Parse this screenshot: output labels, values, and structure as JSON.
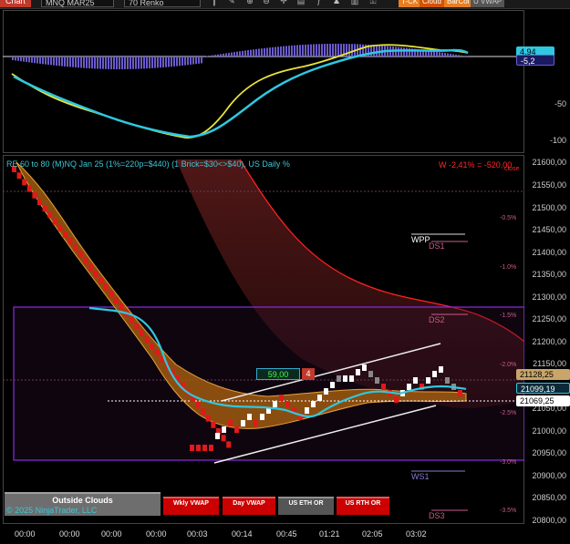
{
  "toolbar": {
    "tab": "Chart",
    "instrument": "MNQ MAR25",
    "bar_type": "70 Renko",
    "buttons": [
      "T-CK",
      "Cloud",
      "BarCol",
      "U VWAP"
    ],
    "icons": [
      "bars-icon",
      "draw-icon",
      "zoom-in-icon",
      "zoom-out-icon",
      "crosshair-icon",
      "properties-icon",
      "indicators-icon",
      "strategies-icon",
      "templates-icon",
      "lock-icon"
    ]
  },
  "colors": {
    "upper_line": "#ff2020",
    "cloud_fill": "#a05a10",
    "cloud_edge": "#e6a23c",
    "cyan": "#2ec8e0",
    "yellow": "#e8e43a",
    "histogram": "#6a5acd",
    "purple_box": "#8a2be2",
    "pink": "#c85c8a"
  },
  "lower_panel": {
    "axis_labels": [
      "-50",
      "-100"
    ],
    "value_label_top": "4.94",
    "value_label": "-5,2"
  },
  "main_panel": {
    "header": "RE 60 to 80 (M)NQ Jan 25 (1%=220p=$440) (1 Brick=$30<>$40), US Daily %",
    "w_label": "W -2,41% = -520,00",
    "close_label": "close",
    "price_labels": [
      "21600,00",
      "21550,00",
      "21500,00",
      "21450,00",
      "21400,00",
      "21350,00",
      "21300,00",
      "21250,00",
      "21200,00",
      "21150,00",
      "21050,00",
      "21000,00",
      "20950,00",
      "20900,00",
      "20850,00",
      "20800,00"
    ],
    "price_pills": {
      "p1": "21128,25",
      "p2": "21099,19",
      "p3": "21069,25"
    },
    "pct_labels": [
      "-0.5%",
      "-1.0%",
      "-1.5%",
      "-2.0%",
      "-2.5%",
      "-3.0%",
      "-3.5%"
    ],
    "levels": {
      "wpp": "WPP",
      "ds1": "DS1",
      "ds2": "DS2",
      "ws1": "WS1",
      "ds3": "DS3"
    },
    "badge_value": "59,00",
    "badge_count": "4"
  },
  "buttons": {
    "outside_clouds": "Outside Clouds",
    "wkly_vwap": "Wkly VWAP",
    "day_vwap": "Day VWAP",
    "us_eth_or": "US ETH OR",
    "us_rth_or": "US RTH OR"
  },
  "copyright": "© 2025 NinjaTrader, LLC",
  "time_axis": [
    "00:00",
    "00:00",
    "00:00",
    "00:00",
    "00:03",
    "00:14",
    "00:45",
    "01:21",
    "02:05",
    "03:02"
  ]
}
